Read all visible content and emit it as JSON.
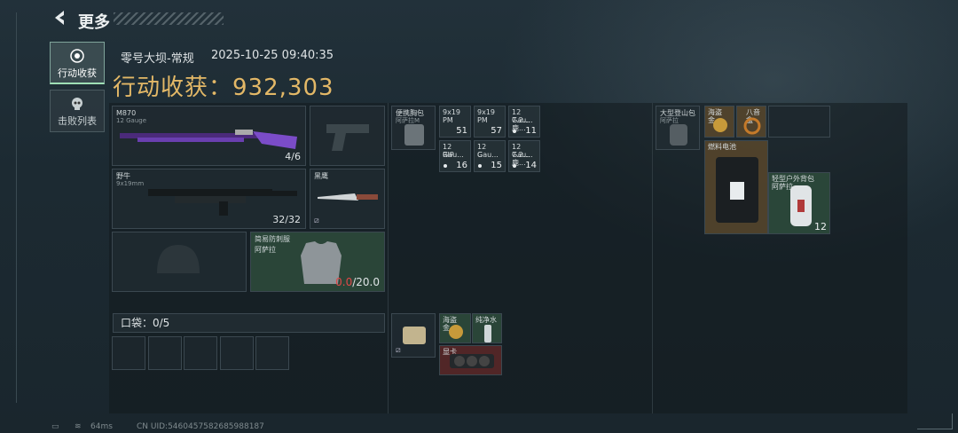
{
  "header": {
    "back_icon": "back-arrow-icon",
    "title": "更多"
  },
  "tabs": [
    {
      "label": "行动收获",
      "icon": "loot-icon",
      "active": true
    },
    {
      "label": "击败列表",
      "icon": "skull-icon",
      "active": false
    }
  ],
  "raid": {
    "map": "零号大坝-常规",
    "time": "2025-10-25 09:40:35",
    "haul_label": "行动收获：",
    "haul_value": "932,303"
  },
  "weapons": [
    {
      "name": "M870",
      "ammo": "12 Gauge",
      "count": "4/6"
    },
    {
      "name": "野牛",
      "ammo": "9x19mm",
      "count": "32/32"
    }
  ],
  "pistol_slot": {
    "icon": "pistol-icon"
  },
  "knife": {
    "name": "黑鹰",
    "icon": "knife-icon"
  },
  "helmet_slot": {
    "icon": "helmet-icon"
  },
  "armor": {
    "name": "简易防刺服",
    "sub": "阿萨拉",
    "durability_current": "0.0",
    "durability_max": "/20.0"
  },
  "chest_rig": {
    "name": "便携胸包",
    "sub": "阿萨拉M"
  },
  "rig_items": [
    {
      "name": "9x19",
      "sub": "PM",
      "count": "51"
    },
    {
      "name": "9x19",
      "sub": "PM",
      "count": "57"
    },
    {
      "name": "12 Gau...",
      "sub": "7.2...鹿...",
      "count": "11"
    },
    {
      "name": "12 Gau...",
      "sub": "RIP",
      "count": "16"
    },
    {
      "name": "12 Gau...",
      "sub": "G",
      "count": "15"
    },
    {
      "name": "12 Gau...",
      "sub": "7.2...鹿...",
      "count": "14"
    }
  ],
  "backpack": {
    "name": "大型登山包",
    "sub": "阿萨拉"
  },
  "backpack_items": [
    {
      "name": "海盗金...",
      "type": "gold"
    },
    {
      "name": "八音盒",
      "type": "gold"
    },
    {
      "name": "燃料电池",
      "type": "green"
    },
    {
      "name": "轻型户外背包",
      "sub": "阿萨拉",
      "count": "12",
      "type": "green"
    }
  ],
  "pocket": {
    "label": "口袋：0/5"
  },
  "case": {
    "icon": "case-icon"
  },
  "case_items": [
    {
      "name": "海盗金...",
      "type": "green"
    },
    {
      "name": "纯净水",
      "type": "green"
    },
    {
      "name": "显卡",
      "type": "red"
    }
  ],
  "footer": {
    "ping": "64ms",
    "uid": "CN UID:5460457582685988187"
  }
}
